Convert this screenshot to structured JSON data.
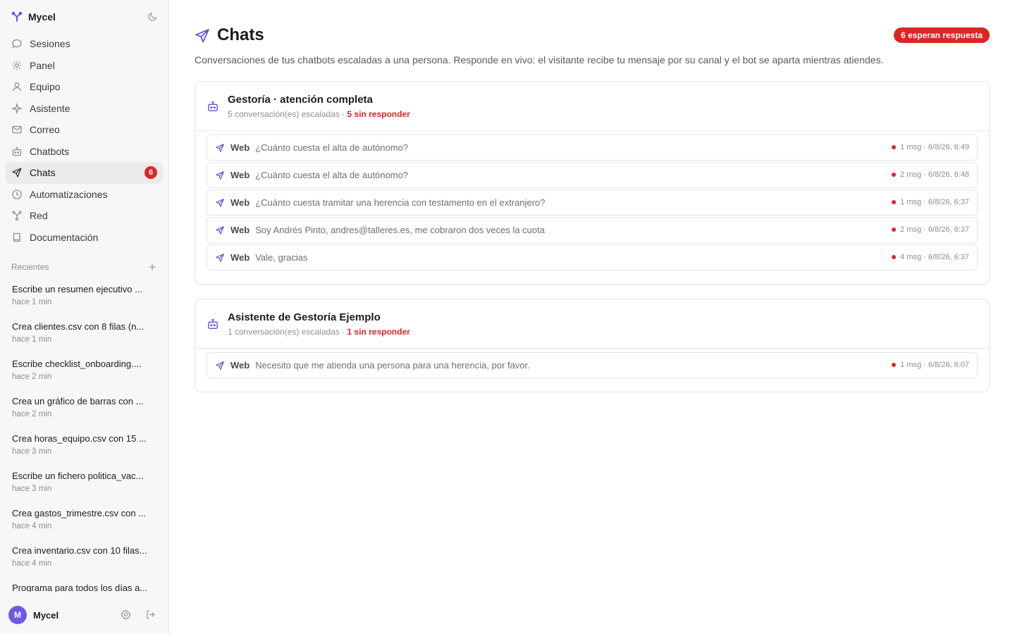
{
  "app": {
    "name": "Mycel"
  },
  "sidebar": {
    "items": [
      {
        "label": "Sesiones",
        "icon": "chat-bubble-icon"
      },
      {
        "label": "Panel",
        "icon": "gear-icon"
      },
      {
        "label": "Equipo",
        "icon": "user-icon"
      },
      {
        "label": "Asistente",
        "icon": "sparkle-icon"
      },
      {
        "label": "Correo",
        "icon": "mail-icon"
      },
      {
        "label": "Chatbots",
        "icon": "bot-icon"
      },
      {
        "label": "Chats",
        "icon": "send-icon",
        "active": true,
        "badge": "6"
      },
      {
        "label": "Automatizaciones",
        "icon": "clock-icon"
      },
      {
        "label": "Red",
        "icon": "network-icon"
      },
      {
        "label": "Documentación",
        "icon": "book-icon"
      }
    ],
    "recents_title": "Recientes",
    "recents": [
      {
        "text": "Escribe un resumen ejecutivo ...",
        "time": "hace 1 min"
      },
      {
        "text": "Crea clientes.csv con 8 filas (n...",
        "time": "hace 1 min"
      },
      {
        "text": "Escribe checklist_onboarding....",
        "time": "hace 2 min"
      },
      {
        "text": "Crea un gráfico de barras con ...",
        "time": "hace 2 min"
      },
      {
        "text": "Crea horas_equipo.csv con 15 ...",
        "time": "hace 3 min"
      },
      {
        "text": "Escribe un fichero politica_vac...",
        "time": "hace 3 min"
      },
      {
        "text": "Crea gastos_trimestre.csv con ...",
        "time": "hace 4 min"
      },
      {
        "text": "Crea inventario.csv con 10 filas...",
        "time": "hace 4 min"
      },
      {
        "text": "Programa para todos los días a...",
        "time": ""
      }
    ],
    "user": {
      "initial": "M",
      "name": "Mycel"
    }
  },
  "main": {
    "title": "Chats",
    "pending_badge": "6 esperan respuesta",
    "subtitle": "Conversaciones de tus chatbots escaladas a una persona. Responde en vivo: el visitante recibe tu mensaje por su canal y el bot se aparta mientras atiendes.",
    "groups": [
      {
        "title": "Gestoría · atención completa",
        "meta": "5 conversación(es) escaladas · ",
        "unanswered": "5 sin responder",
        "rows": [
          {
            "channel": "Web",
            "text": "¿Cuánto cuesta el alta de autónomo?",
            "meta": "1 msg · 6/8/26, 6:49"
          },
          {
            "channel": "Web",
            "text": "¿Cuánto cuesta el alta de autónomo?",
            "meta": "2 msg · 6/8/26, 6:48"
          },
          {
            "channel": "Web",
            "text": "¿Cuánto cuesta tramitar una herencia con testamento en el extranjero?",
            "meta": "1 msg · 6/8/26, 6:37"
          },
          {
            "channel": "Web",
            "text": "Soy Andrés Pinto, andres@talleres.es, me cobraron dos veces la cuota",
            "meta": "2 msg · 6/8/26, 6:37"
          },
          {
            "channel": "Web",
            "text": "Vale, gracias",
            "meta": "4 msg · 6/8/26, 6:37"
          }
        ]
      },
      {
        "title": "Asistente de Gestoría Ejemplo",
        "meta": "1 conversación(es) escaladas · ",
        "unanswered": "1 sin responder",
        "rows": [
          {
            "channel": "Web",
            "text": "Necesito que me atienda una persona para una herencia, por favor.",
            "meta": "1 msg · 6/8/26, 6:07"
          }
        ]
      }
    ]
  },
  "colors": {
    "accent": "#6d5be8",
    "alert": "#dc2626"
  }
}
